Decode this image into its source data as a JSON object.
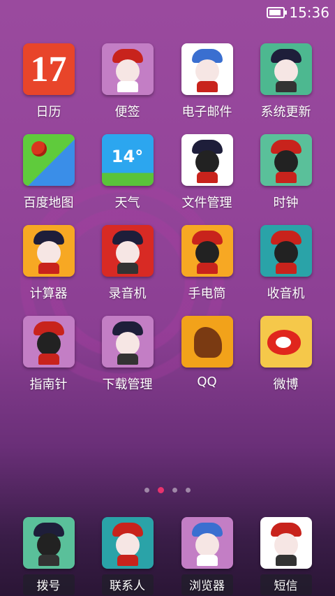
{
  "status_bar": {
    "time": "15:36",
    "battery_icon": "battery-icon",
    "battery_level": 0.85
  },
  "page_indicator": {
    "count": 4,
    "active": 2
  },
  "apps": [
    {
      "id": "calendar",
      "label": "日历",
      "icon_text": "17",
      "icon": "calendar-icon"
    },
    {
      "id": "notes",
      "label": "便签",
      "icon": "opera-character-icon"
    },
    {
      "id": "email",
      "label": "电子邮件",
      "icon": "opera-character-icon"
    },
    {
      "id": "system-update",
      "label": "系统更新",
      "icon": "opera-character-icon"
    },
    {
      "id": "baidu-map",
      "label": "百度地图",
      "icon": "map-icon"
    },
    {
      "id": "weather",
      "label": "天气",
      "icon_text": "14°",
      "icon": "weather-icon"
    },
    {
      "id": "file-manager",
      "label": "文件管理",
      "icon": "opera-character-icon"
    },
    {
      "id": "clock",
      "label": "时钟",
      "icon": "opera-character-icon"
    },
    {
      "id": "calculator",
      "label": "计算器",
      "icon": "opera-character-icon"
    },
    {
      "id": "recorder",
      "label": "录音机",
      "icon": "opera-character-icon"
    },
    {
      "id": "flashlight",
      "label": "手电筒",
      "icon": "opera-character-icon"
    },
    {
      "id": "radio",
      "label": "收音机",
      "icon": "opera-character-icon"
    },
    {
      "id": "compass",
      "label": "指南针",
      "icon": "opera-character-icon"
    },
    {
      "id": "download-manager",
      "label": "下载管理",
      "icon": "opera-character-icon"
    },
    {
      "id": "qq",
      "label": "QQ",
      "icon": "qq-horse-rider-icon"
    },
    {
      "id": "weibo",
      "label": "微博",
      "icon": "weibo-icon"
    }
  ],
  "dock": [
    {
      "id": "dialer",
      "label": "拨号",
      "icon": "opera-character-icon"
    },
    {
      "id": "contacts",
      "label": "联系人",
      "icon": "opera-character-icon"
    },
    {
      "id": "browser",
      "label": "浏览器",
      "icon": "opera-character-icon"
    },
    {
      "id": "messages",
      "label": "短信",
      "icon": "opera-character-icon"
    }
  ],
  "colors": {
    "accent": "#e8336d",
    "wallpaper": "#94459a"
  }
}
